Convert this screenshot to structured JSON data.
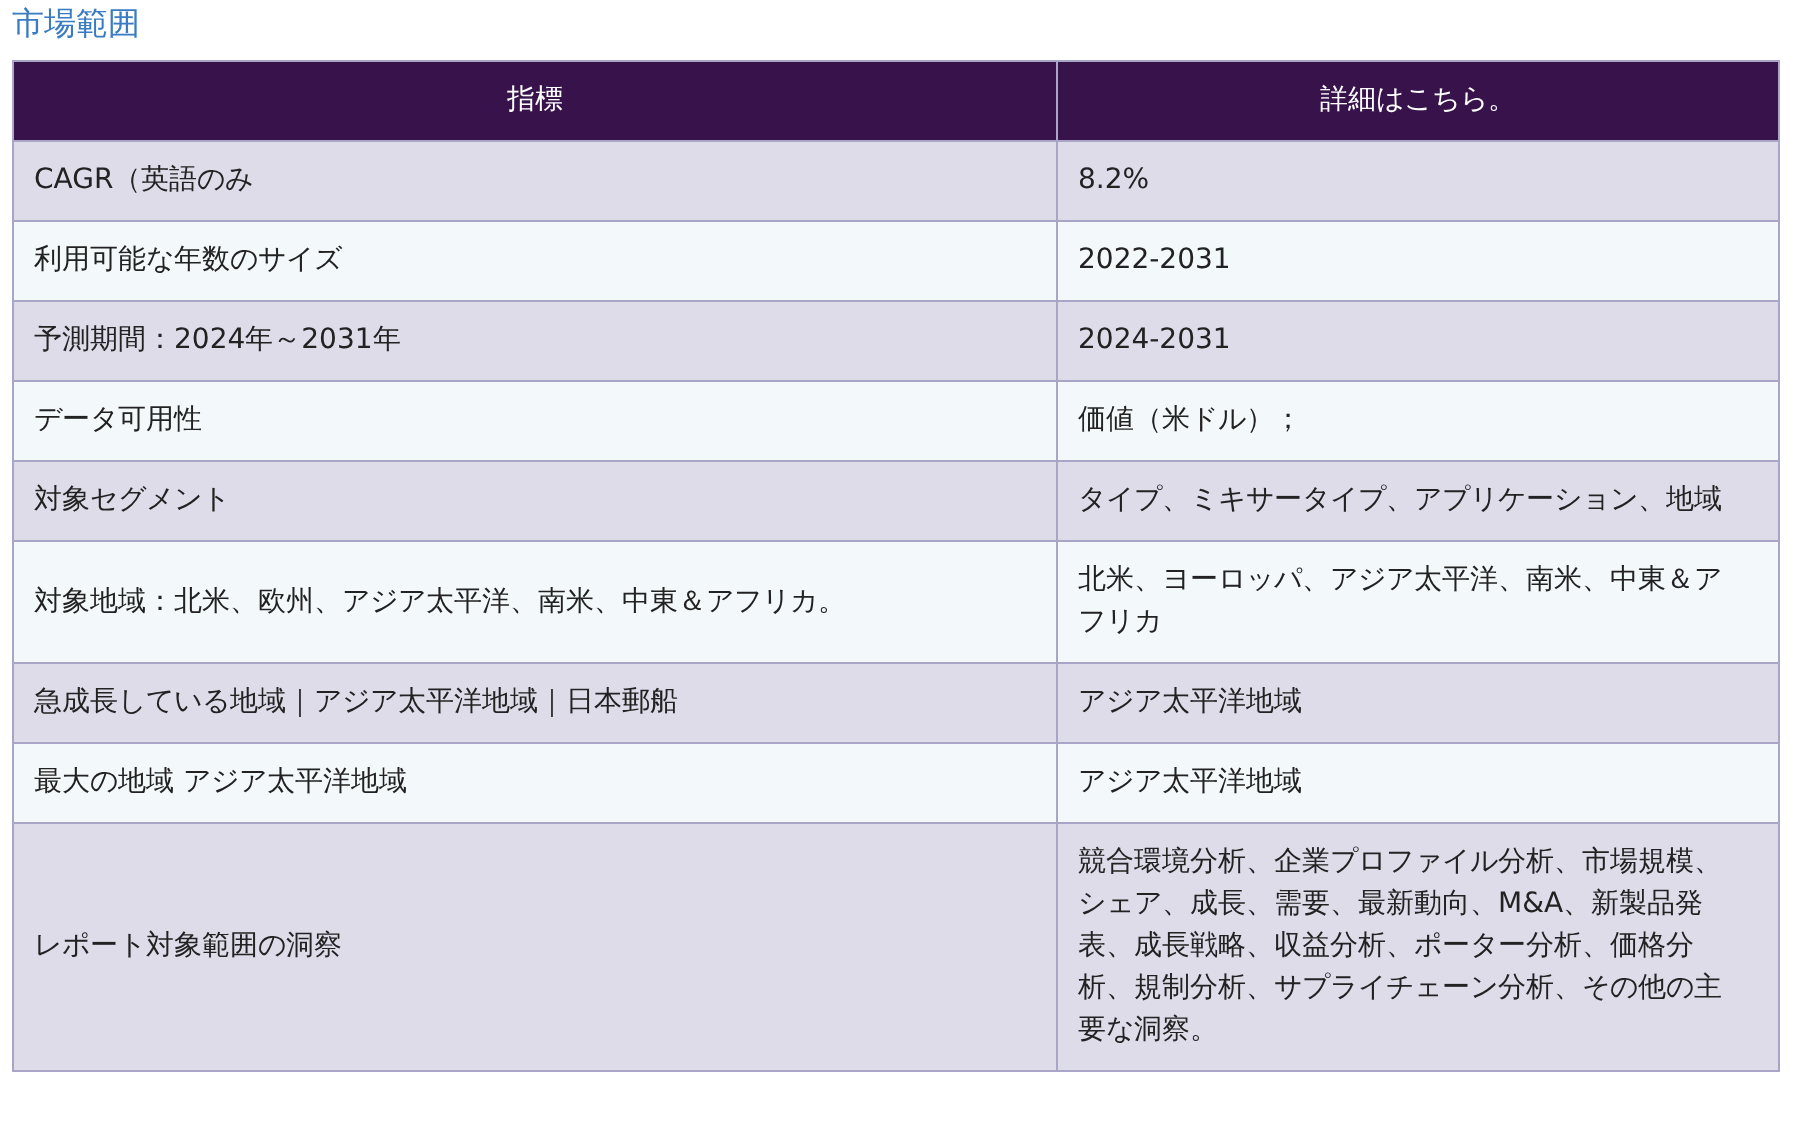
{
  "title": "市場範囲",
  "table": {
    "columns": [
      "指標",
      "詳細はこちら。"
    ],
    "rows": [
      {
        "cells": [
          "CAGR（英語のみ",
          "8.2%"
        ]
      },
      {
        "cells": [
          "利用可能な年数のサイズ",
          "2022-2031"
        ]
      },
      {
        "cells": [
          "予測期間：2024年～2031年",
          "2024-2031"
        ]
      },
      {
        "cells": [
          "データ可用性",
          "価値（米ドル）；"
        ]
      },
      {
        "cells": [
          "対象セグメント",
          "タイプ、ミキサータイプ、アプリケーション、地域"
        ]
      },
      {
        "cells": [
          "対象地域：北米、欧州、アジア太平洋、南米、中東＆アフリカ。",
          "北米、ヨーロッパ、アジア太平洋、南米、中東＆アフリカ"
        ]
      },
      {
        "cells": [
          "急成長している地域｜アジア太平洋地域｜日本郵船",
          "アジア太平洋地域"
        ]
      },
      {
        "cells": [
          "最大の地域 アジア太平洋地域",
          "アジア太平洋地域"
        ]
      },
      {
        "cells": [
          "レポート対象範囲の洞察",
          "競合環境分析、企業プロファイル分析、市場規模、シェア、成長、需要、最新動向、M&A、新製品発表、成長戦略、収益分析、ポーター分析、価格分析、規制分析、サプライチェーン分析、その他の主要な洞察。"
        ]
      }
    ]
  }
}
